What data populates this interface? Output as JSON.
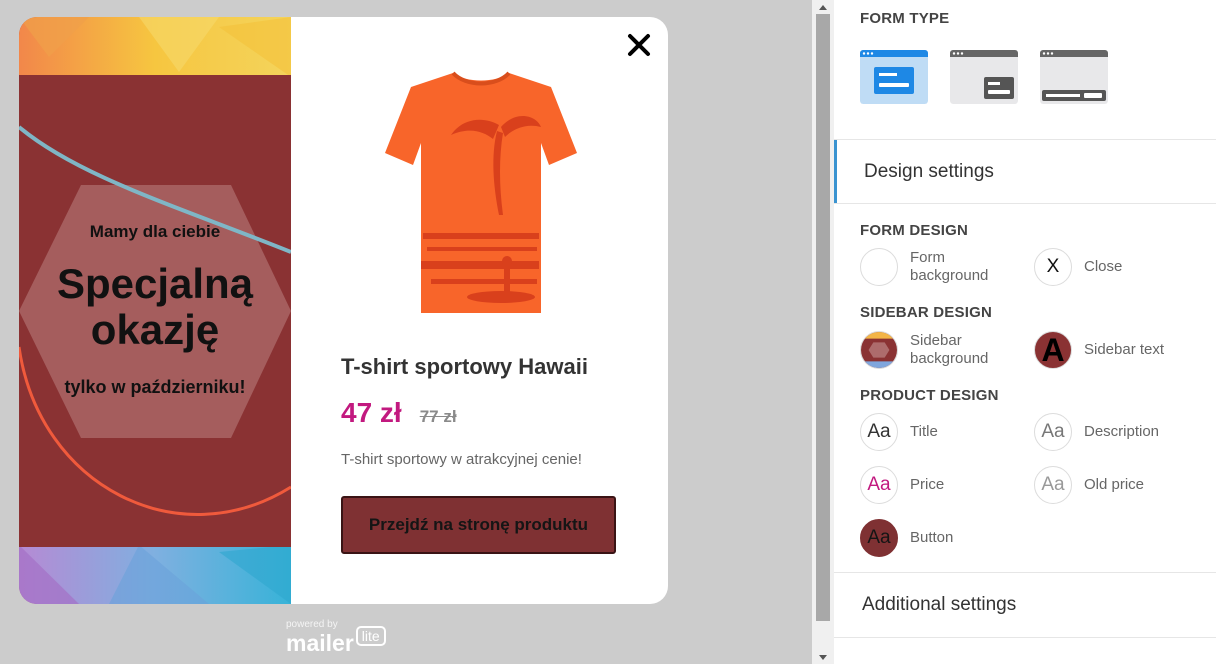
{
  "popup": {
    "sidebar": {
      "pre_heading": "Mamy dla ciebie",
      "heading_line1": "Specjalną",
      "heading_line2": "okazję",
      "post_heading": "tylko w październiku!"
    },
    "product": {
      "title": "T-shirt sportowy Hawaii",
      "price": "47 zł",
      "old_price": "77 zł",
      "description": "T-shirt sportowy w atrakcyjnej cenie!",
      "button_label": "Przejdź na stronę produktu"
    },
    "close_icon": "close-icon"
  },
  "branding": {
    "powered_by": "powered by",
    "brand": "mailer",
    "badge": "lite"
  },
  "panel": {
    "form_type_label": "FORM TYPE",
    "form_types": [
      "popup-centered",
      "popup-corner",
      "popup-bar"
    ],
    "design_settings_label": "Design settings",
    "form_design": {
      "label": "FORM DESIGN",
      "items": [
        {
          "label_line1": "Form",
          "label_line2": "background",
          "color": "#ffffff"
        },
        {
          "label_line1": "Close",
          "label_line2": "",
          "glyph": "X"
        }
      ]
    },
    "sidebar_design": {
      "label": "SIDEBAR DESIGN",
      "items": [
        {
          "label_line1": "Sidebar",
          "label_line2": "background",
          "color": "#8a3233"
        },
        {
          "label_line1": "Sidebar text",
          "label_line2": "",
          "glyph": "A"
        }
      ]
    },
    "product_design": {
      "label": "PRODUCT DESIGN",
      "items": [
        {
          "label": "Title",
          "glyph": "Aa",
          "color": "#333333"
        },
        {
          "label": "Description",
          "glyph": "Aa",
          "color": "#777777"
        },
        {
          "label": "Price",
          "glyph": "Aa",
          "color": "#c2197f"
        },
        {
          "label": "Old price",
          "glyph": "Aa",
          "color": "#999999"
        },
        {
          "label": "Button",
          "glyph": "Aa",
          "color": "#151515",
          "bg": "#7f3133"
        }
      ]
    },
    "additional_settings_label": "Additional settings"
  },
  "colors": {
    "accent": "#3a93d0",
    "price": "#c2197f",
    "button_bg": "#7f3133",
    "sidebar_bg": "#8a3233"
  }
}
